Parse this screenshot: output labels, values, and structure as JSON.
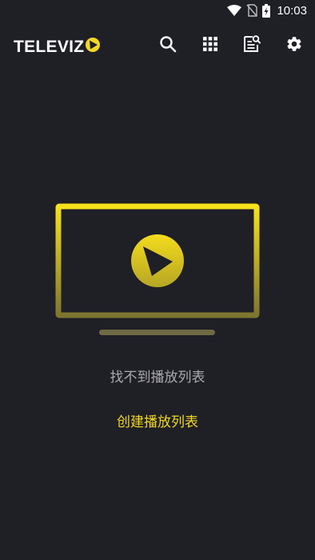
{
  "status_bar": {
    "time": "10:03",
    "icons": [
      "wifi-icon",
      "no-sim-icon",
      "battery-charging-icon"
    ]
  },
  "toolbar": {
    "logo_text": "TELEVIZ",
    "logo_mark": "play-circle-logo-icon",
    "actions": [
      "search-icon",
      "grid-icon",
      "epg-search-icon",
      "gear-icon"
    ]
  },
  "empty_state": {
    "illustration": "tv-play-icon",
    "message": "找不到播放列表",
    "action_label": "创建播放列表"
  },
  "colors": {
    "background": "#1f1f26",
    "accent": "#f2d821",
    "text_muted": "#a8a8ad"
  }
}
